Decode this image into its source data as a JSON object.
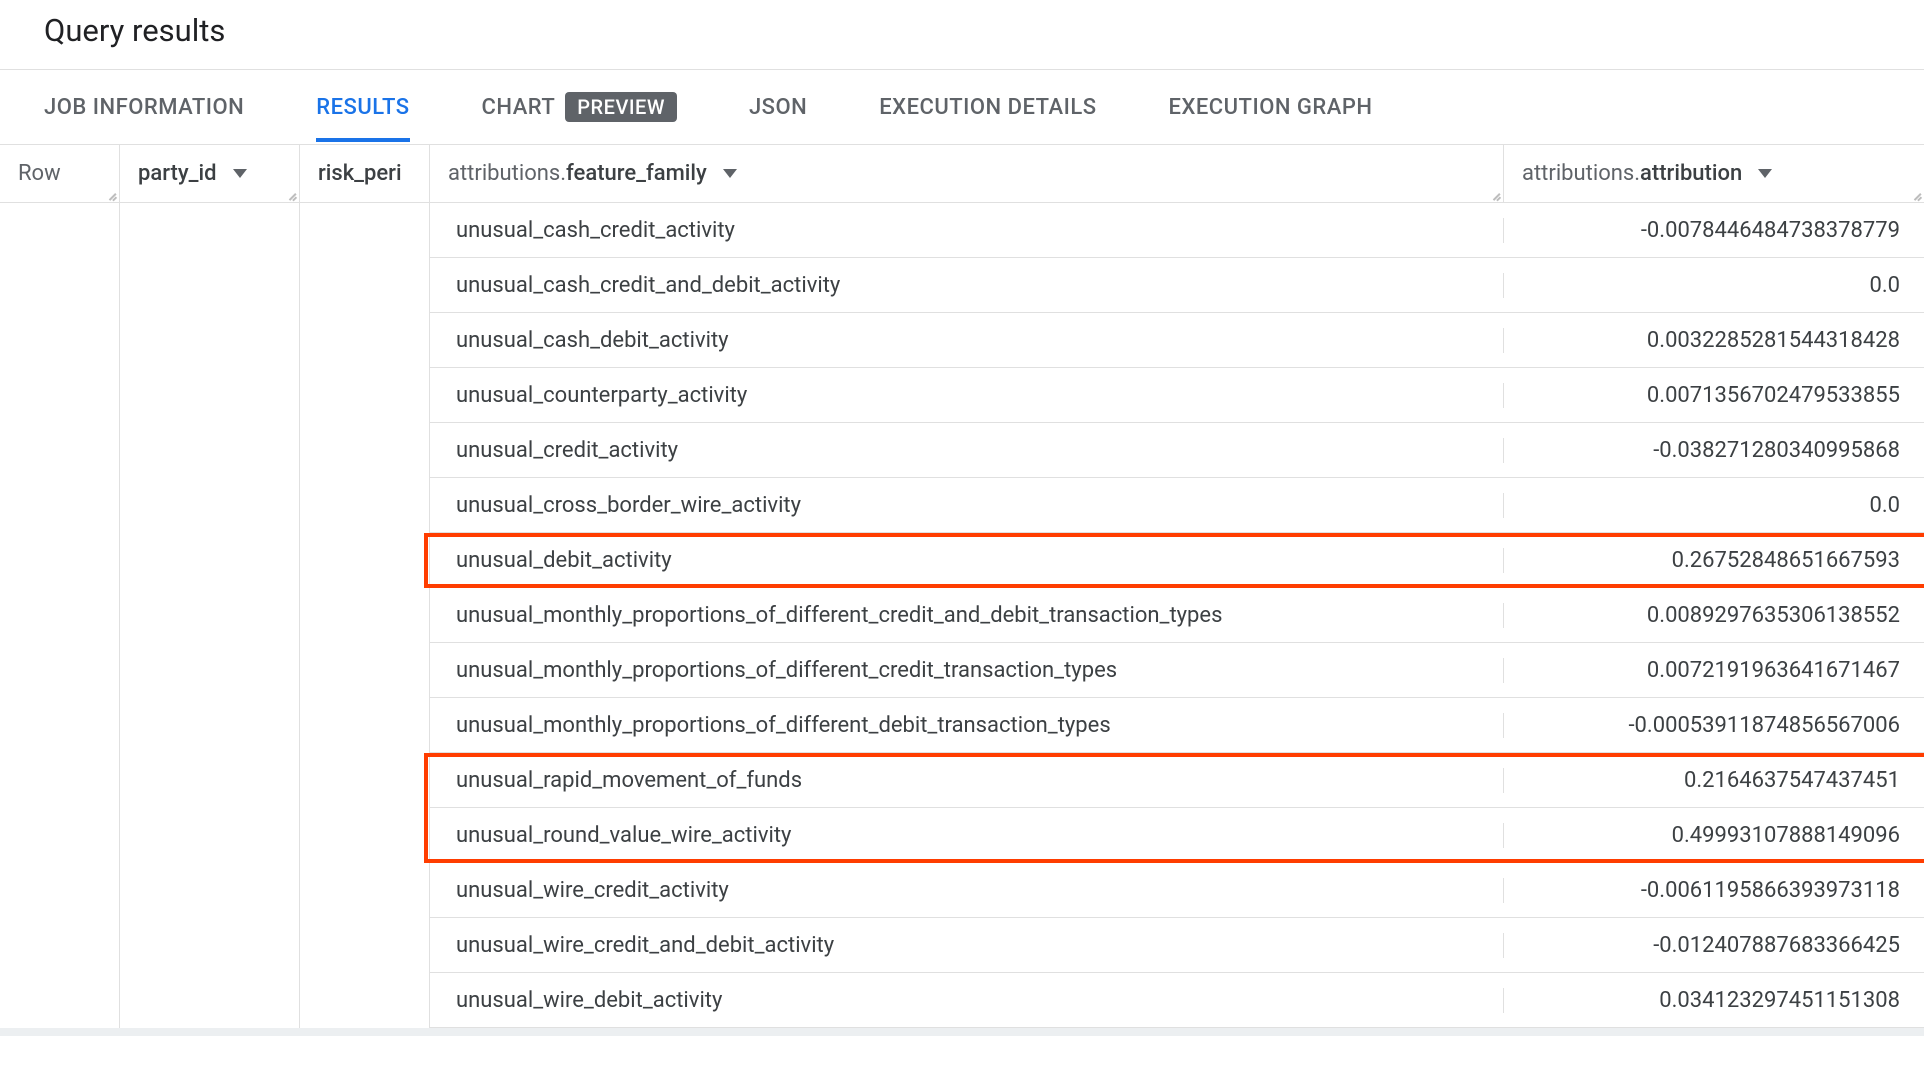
{
  "title": "Query results",
  "tabs": {
    "job_info": "JOB INFORMATION",
    "results": "RESULTS",
    "chart": "CHART",
    "chart_badge": "PREVIEW",
    "json": "JSON",
    "exec_details": "EXECUTION DETAILS",
    "exec_graph": "EXECUTION GRAPH"
  },
  "columns": {
    "row": "Row",
    "party_id": "party_id",
    "risk_peri": "risk_peri",
    "feature_family_prefix": "attributions.",
    "feature_family_bold": "feature_family",
    "attribution_prefix": "attributions.",
    "attribution_bold": "attribution"
  },
  "rows": [
    {
      "feature_family": "unusual_cash_credit_activity",
      "attribution": "-0.0078446484738378779"
    },
    {
      "feature_family": "unusual_cash_credit_and_debit_activity",
      "attribution": "0.0"
    },
    {
      "feature_family": "unusual_cash_debit_activity",
      "attribution": "0.0032285281544318428"
    },
    {
      "feature_family": "unusual_counterparty_activity",
      "attribution": "0.0071356702479533855"
    },
    {
      "feature_family": "unusual_credit_activity",
      "attribution": "-0.038271280340995868"
    },
    {
      "feature_family": "unusual_cross_border_wire_activity",
      "attribution": "0.0"
    },
    {
      "feature_family": "unusual_debit_activity",
      "attribution": "0.26752848651667593"
    },
    {
      "feature_family": "unusual_monthly_proportions_of_different_credit_and_debit_transaction_types",
      "attribution": "0.0089297635306138552"
    },
    {
      "feature_family": "unusual_monthly_proportions_of_different_credit_transaction_types",
      "attribution": "0.0072191963641671467"
    },
    {
      "feature_family": "unusual_monthly_proportions_of_different_debit_transaction_types",
      "attribution": "-0.00053911874856567006"
    },
    {
      "feature_family": "unusual_rapid_movement_of_funds",
      "attribution": "0.2164637547437451"
    },
    {
      "feature_family": "unusual_round_value_wire_activity",
      "attribution": "0.49993107888149096"
    },
    {
      "feature_family": "unusual_wire_credit_activity",
      "attribution": "-0.0061195866393973118"
    },
    {
      "feature_family": "unusual_wire_credit_and_debit_activity",
      "attribution": "-0.012407887683366425"
    },
    {
      "feature_family": "unusual_wire_debit_activity",
      "attribution": "0.034123297451151308"
    }
  ],
  "highlighted_row_indices": [
    6,
    10,
    11
  ]
}
